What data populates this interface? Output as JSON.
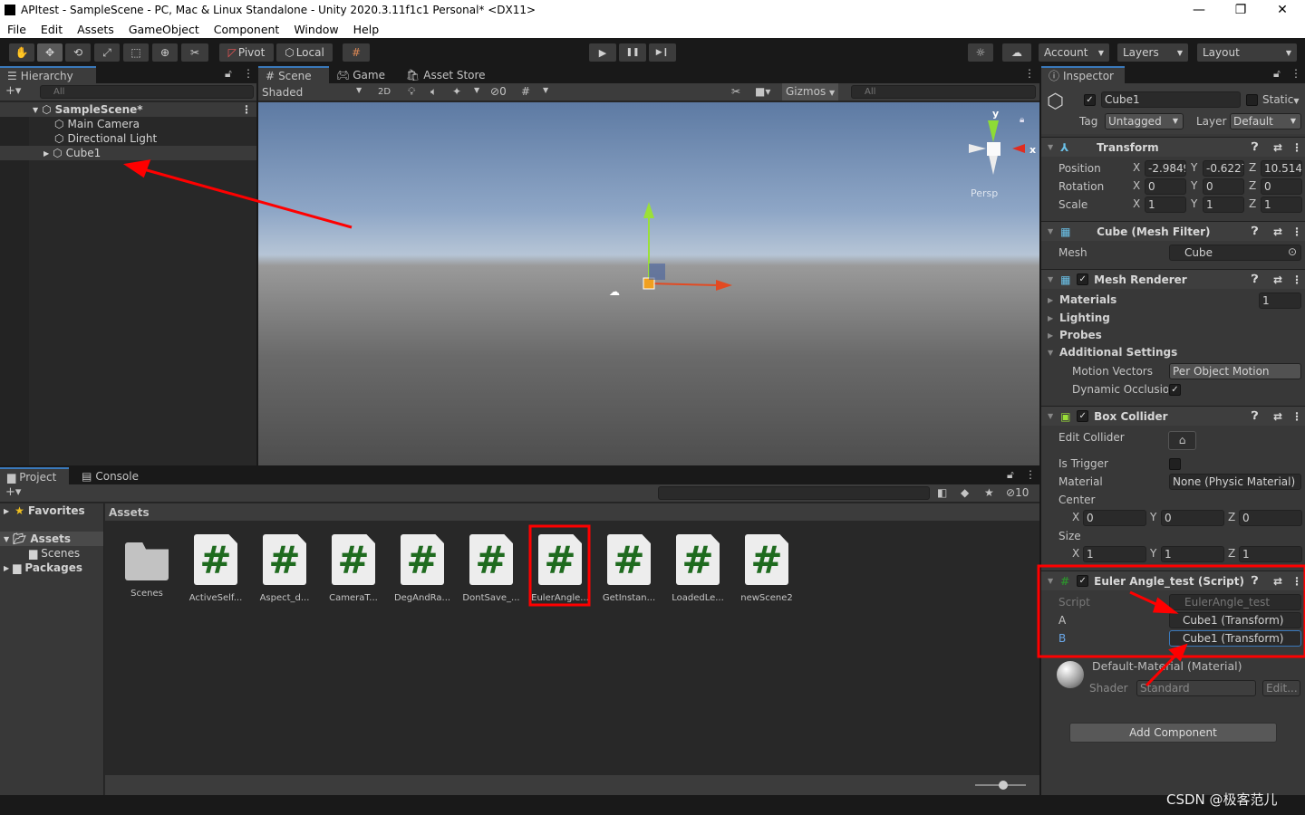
{
  "window": {
    "title": "APItest - SampleScene - PC, Mac & Linux Standalone - Unity 2020.3.11f1c1 Personal* <DX11>",
    "minimize": "—",
    "maximize": "❐",
    "close": "✕"
  },
  "menu": [
    "File",
    "Edit",
    "Assets",
    "GameObject",
    "Component",
    "Window",
    "Help"
  ],
  "toolbar": {
    "pivot": "Pivot",
    "local": "Local",
    "account": "Account",
    "layers": "Layers",
    "layout": "Layout",
    "play": "▶",
    "pause": "❚❚",
    "step": "▶❙"
  },
  "hierarchy": {
    "tab": "Hierarchy",
    "search_placeholder": "All",
    "add": "+▾",
    "scene": "SampleScene*",
    "items": [
      "Main Camera",
      "Directional Light",
      "Cube1"
    ]
  },
  "scene": {
    "tabs": [
      "Scene",
      "Game",
      "Asset Store"
    ],
    "shading": "Shaded",
    "mode2d": "2D",
    "hidden_count": "0",
    "gizmos": "Gizmos",
    "search_placeholder": "All",
    "persp": "Persp",
    "axis_x": "x",
    "axis_y": "y"
  },
  "inspector": {
    "tab": "Inspector",
    "name": "Cube1",
    "static": "Static",
    "tag_label": "Tag",
    "tag": "Untagged",
    "layer_label": "Layer",
    "layer": "Default",
    "transform": {
      "title": "Transform",
      "rows": [
        {
          "label": "Position",
          "x": "-2.9849",
          "y": "-0.6227",
          "z": "10.5141"
        },
        {
          "label": "Rotation",
          "x": "0",
          "y": "0",
          "z": "0"
        },
        {
          "label": "Scale",
          "x": "1",
          "y": "1",
          "z": "1"
        }
      ]
    },
    "mesh_filter": {
      "title": "Cube (Mesh Filter)",
      "mesh_label": "Mesh",
      "mesh": "Cube"
    },
    "mesh_renderer": {
      "title": "Mesh Renderer",
      "materials": "Materials",
      "materials_count": "1",
      "lighting": "Lighting",
      "probes": "Probes",
      "additional": "Additional Settings",
      "motion_vectors_label": "Motion Vectors",
      "motion_vectors": "Per Object Motion",
      "dynamic_occlusion_label": "Dynamic Occlusion",
      "dynamic_occlusion": true
    },
    "box_collider": {
      "title": "Box Collider",
      "edit_collider": "Edit Collider",
      "is_trigger": "Is Trigger",
      "material_label": "Material",
      "material": "None (Physic Material)",
      "center": "Center",
      "center_xyz": [
        "0",
        "0",
        "0"
      ],
      "size": "Size",
      "size_xyz": [
        "1",
        "1",
        "1"
      ]
    },
    "script": {
      "title": "Euler Angle_test (Script)",
      "script_label": "Script",
      "script": "EulerAngle_test",
      "a_label": "A",
      "a": "Cube1 (Transform)",
      "b_label": "B",
      "b": "Cube1 (Transform)"
    },
    "material": {
      "title": "Default-Material (Material)",
      "shader_label": "Shader",
      "shader": "Standard",
      "edit": "Edit..."
    },
    "add_component": "Add Component"
  },
  "project": {
    "tabs": [
      "Project",
      "Console"
    ],
    "hidden_count": "10",
    "favorites": "Favorites",
    "assets": "Assets",
    "scenes": "Scenes",
    "packages": "Packages",
    "breadcrumb": "Assets",
    "items": [
      "Scenes",
      "ActiveSelf...",
      "Aspect_d...",
      "CameraT...",
      "DegAndRa...",
      "DontSave_...",
      "EulerAngle...",
      "GetInstan...",
      "LoadedLe...",
      "newScene2"
    ]
  },
  "watermark": "CSDN @极客范儿",
  "colors": {
    "accent": "#3a79bb",
    "annotation": "#ff0000",
    "script_icon": "#1f6b1f"
  }
}
